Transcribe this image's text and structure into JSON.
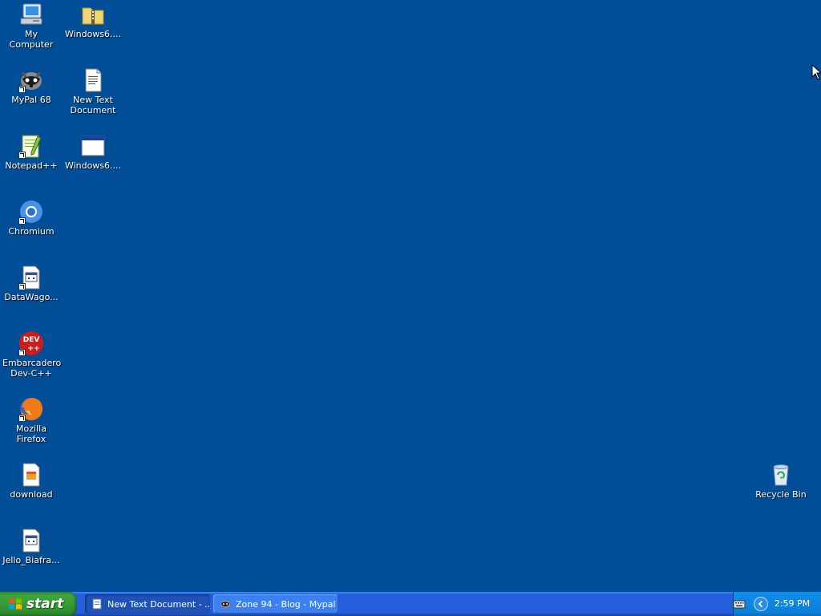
{
  "desktop": {
    "background_color": "#004e98",
    "icons": [
      {
        "label": "My Computer",
        "icon": "my-computer-icon"
      },
      {
        "label": "Windows6....",
        "icon": "zip-folder-icon"
      },
      {
        "label": "MyPal 68",
        "icon": "mypal-icon",
        "shortcut": true
      },
      {
        "label": "New Text Document",
        "icon": "text-document-icon"
      },
      {
        "label": "Notepad++",
        "icon": "notepadpp-icon",
        "shortcut": true
      },
      {
        "label": "Windows6....",
        "icon": "window-app-icon"
      },
      {
        "label": "Chromium",
        "icon": "chromium-icon",
        "shortcut": true
      },
      {
        "label": "DataWago...",
        "icon": "datawagon-icon",
        "shortcut": true
      },
      {
        "label": "Embarcadero Dev-C++",
        "icon": "devcpp-icon",
        "shortcut": true
      },
      {
        "label": "Mozilla Firefox",
        "icon": "firefox-icon",
        "shortcut": true
      },
      {
        "label": "download",
        "icon": "download-file-icon"
      },
      {
        "label": "Jello_Biafra...",
        "icon": "jello-file-icon"
      },
      {
        "label": "Recycle Bin",
        "icon": "recycle-bin-icon"
      }
    ]
  },
  "taskbar": {
    "start_label": "start",
    "tasks": [
      {
        "label": "New Text Document - ...",
        "icon": "notepad-icon",
        "active": true
      },
      {
        "label": "Zone 94 - Blog - Mypal",
        "icon": "mypal-icon",
        "active": false
      }
    ],
    "tray": {
      "clock": "2:59 PM",
      "icons": [
        "keyboard-icon",
        "tray-chevron-icon"
      ]
    }
  },
  "colors": {
    "taskbar": "#245edb",
    "start_button": "#3c9a3c",
    "tray": "#0f8be8"
  }
}
